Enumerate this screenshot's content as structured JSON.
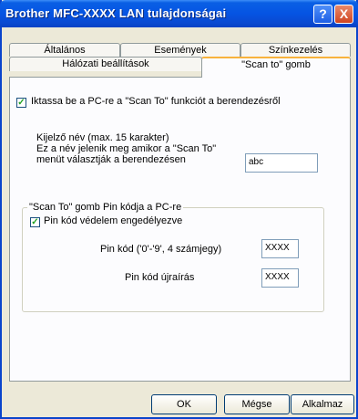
{
  "window": {
    "title": "Brother  MFC-XXXX  LAN tulajdonságai",
    "help": "?",
    "close": "X"
  },
  "tabs": {
    "row1": [
      "Általános",
      "Események",
      "Színkezelés"
    ],
    "row2": [
      "Hálózati beállítások",
      "\"Scan to\" gomb"
    ]
  },
  "scanto": {
    "checkbox_label": "Iktassa be a PC-re a \"Scan To\" funkciót a berendezésről",
    "desc_line1": "Kijelző név (max. 15 karakter)",
    "desc_line2": "Ez a név jelenik meg amikor a \"Scan To\"",
    "desc_line3": "menüt választják a berendezésen",
    "name_value": "abc"
  },
  "pin_group": {
    "legend": "\"Scan To\" gomb Pin kódja a PC-re",
    "enable_label": "Pin kód védelem engedélyezve",
    "pin_label": "Pin kód ('0'-'9', 4 számjegy)",
    "pin_value": "XXXX",
    "repeat_label": "Pin kód újraírás",
    "repeat_value": "XXXX"
  },
  "buttons": {
    "ok": "OK",
    "cancel": "Mégse",
    "apply": "Alkalmaz"
  }
}
